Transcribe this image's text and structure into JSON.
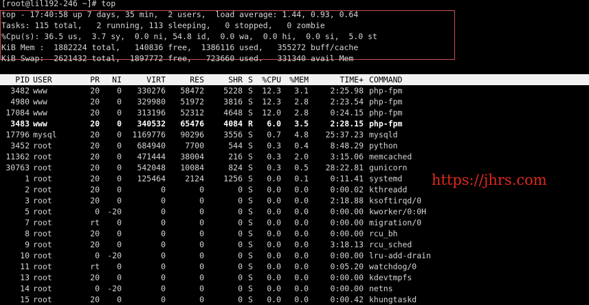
{
  "prompt_line": "[root@lil192-246 ~]# top",
  "summary": {
    "uptime": "top - 17:40:58 up 7 days, 35 min,  2 users,  load average: 1.44, 0.93, 0.64",
    "tasks": "Tasks: 115 total,   2 running, 113 sleeping,   0 stopped,   0 zombie",
    "cpu": "%Cpu(s): 36.5 us,  3.7 sy,  0.0 ni, 54.8 id,  0.0 wa,  0.0 hi,  0.0 si,  5.0 st",
    "mem": "KiB Mem :  1882224 total,   140836 free,  1386116 used,   355272 buff/cache",
    "swap": "KiB Swap:  2621432 total,  1897772 free,   723660 used.   331340 avail Mem"
  },
  "columns": [
    "PID",
    "USER",
    "PR",
    "NI",
    "VIRT",
    "RES",
    "SHR",
    "S",
    "%CPU",
    "%MEM",
    "TIME+",
    "COMMAND"
  ],
  "processes": [
    {
      "pid": "3482",
      "user": "www",
      "pr": "20",
      "ni": "0",
      "virt": "330276",
      "res": "58472",
      "shr": "5228",
      "s": "S",
      "cpu": "12.3",
      "mem": "3.1",
      "time": "2:25.98",
      "cmd": "php-fpm",
      "bold": false
    },
    {
      "pid": "4980",
      "user": "www",
      "pr": "20",
      "ni": "0",
      "virt": "329980",
      "res": "51972",
      "shr": "3816",
      "s": "S",
      "cpu": "12.3",
      "mem": "2.8",
      "time": "2:23.54",
      "cmd": "php-fpm",
      "bold": false
    },
    {
      "pid": "17084",
      "user": "www",
      "pr": "20",
      "ni": "0",
      "virt": "313196",
      "res": "52312",
      "shr": "4648",
      "s": "S",
      "cpu": "12.0",
      "mem": "2.8",
      "time": "0:24.15",
      "cmd": "php-fpm",
      "bold": false
    },
    {
      "pid": "3483",
      "user": "www",
      "pr": "20",
      "ni": "0",
      "virt": "340532",
      "res": "65476",
      "shr": "4084",
      "s": "R",
      "cpu": "6.0",
      "mem": "3.5",
      "time": "2:28.15",
      "cmd": "php-fpm",
      "bold": true
    },
    {
      "pid": "17796",
      "user": "mysql",
      "pr": "20",
      "ni": "0",
      "virt": "1169776",
      "res": "90296",
      "shr": "3556",
      "s": "S",
      "cpu": "0.7",
      "mem": "4.8",
      "time": "25:37.23",
      "cmd": "mysqld",
      "bold": false
    },
    {
      "pid": "3452",
      "user": "root",
      "pr": "20",
      "ni": "0",
      "virt": "684940",
      "res": "7700",
      "shr": "544",
      "s": "S",
      "cpu": "0.3",
      "mem": "0.4",
      "time": "8:48.29",
      "cmd": "python",
      "bold": false
    },
    {
      "pid": "11362",
      "user": "root",
      "pr": "20",
      "ni": "0",
      "virt": "471444",
      "res": "38004",
      "shr": "216",
      "s": "S",
      "cpu": "0.3",
      "mem": "2.0",
      "time": "3:15.06",
      "cmd": "memcached",
      "bold": false
    },
    {
      "pid": "30763",
      "user": "root",
      "pr": "20",
      "ni": "0",
      "virt": "542048",
      "res": "10084",
      "shr": "824",
      "s": "S",
      "cpu": "0.3",
      "mem": "0.5",
      "time": "28:22.81",
      "cmd": "gunicorn",
      "bold": false
    },
    {
      "pid": "1",
      "user": "root",
      "pr": "20",
      "ni": "0",
      "virt": "125464",
      "res": "2124",
      "shr": "1256",
      "s": "S",
      "cpu": "0.0",
      "mem": "0.1",
      "time": "0:11.41",
      "cmd": "systemd",
      "bold": false
    },
    {
      "pid": "2",
      "user": "root",
      "pr": "20",
      "ni": "0",
      "virt": "0",
      "res": "0",
      "shr": "0",
      "s": "S",
      "cpu": "0.0",
      "mem": "0.0",
      "time": "0:00.02",
      "cmd": "kthreadd",
      "bold": false
    },
    {
      "pid": "3",
      "user": "root",
      "pr": "20",
      "ni": "0",
      "virt": "0",
      "res": "0",
      "shr": "0",
      "s": "S",
      "cpu": "0.0",
      "mem": "0.0",
      "time": "2:18.88",
      "cmd": "ksoftirqd/0",
      "bold": false
    },
    {
      "pid": "5",
      "user": "root",
      "pr": "0",
      "ni": "-20",
      "virt": "0",
      "res": "0",
      "shr": "0",
      "s": "S",
      "cpu": "0.0",
      "mem": "0.0",
      "time": "0:00.00",
      "cmd": "kworker/0:0H",
      "bold": false
    },
    {
      "pid": "7",
      "user": "root",
      "pr": "rt",
      "ni": "0",
      "virt": "0",
      "res": "0",
      "shr": "0",
      "s": "S",
      "cpu": "0.0",
      "mem": "0.0",
      "time": "0:00.00",
      "cmd": "migration/0",
      "bold": false
    },
    {
      "pid": "8",
      "user": "root",
      "pr": "20",
      "ni": "0",
      "virt": "0",
      "res": "0",
      "shr": "0",
      "s": "S",
      "cpu": "0.0",
      "mem": "0.0",
      "time": "0:00.00",
      "cmd": "rcu_bh",
      "bold": false
    },
    {
      "pid": "9",
      "user": "root",
      "pr": "20",
      "ni": "0",
      "virt": "0",
      "res": "0",
      "shr": "0",
      "s": "S",
      "cpu": "0.0",
      "mem": "0.0",
      "time": "3:18.13",
      "cmd": "rcu_sched",
      "bold": false
    },
    {
      "pid": "10",
      "user": "root",
      "pr": "0",
      "ni": "-20",
      "virt": "0",
      "res": "0",
      "shr": "0",
      "s": "S",
      "cpu": "0.0",
      "mem": "0.0",
      "time": "0:00.00",
      "cmd": "lru-add-drain",
      "bold": false
    },
    {
      "pid": "11",
      "user": "root",
      "pr": "rt",
      "ni": "0",
      "virt": "0",
      "res": "0",
      "shr": "0",
      "s": "S",
      "cpu": "0.0",
      "mem": "0.0",
      "time": "0:05.20",
      "cmd": "watchdog/0",
      "bold": false
    },
    {
      "pid": "13",
      "user": "root",
      "pr": "20",
      "ni": "0",
      "virt": "0",
      "res": "0",
      "shr": "0",
      "s": "S",
      "cpu": "0.0",
      "mem": "0.0",
      "time": "0:00.00",
      "cmd": "kdevtmpfs",
      "bold": false
    },
    {
      "pid": "14",
      "user": "root",
      "pr": "0",
      "ni": "-20",
      "virt": "0",
      "res": "0",
      "shr": "0",
      "s": "S",
      "cpu": "0.0",
      "mem": "0.0",
      "time": "0:00.00",
      "cmd": "netns",
      "bold": false
    },
    {
      "pid": "15",
      "user": "root",
      "pr": "20",
      "ni": "0",
      "virt": "0",
      "res": "0",
      "shr": "0",
      "s": "S",
      "cpu": "0.0",
      "mem": "0.0",
      "time": "0:00.42",
      "cmd": "khungtaskd",
      "bold": false
    }
  ],
  "watermark": "https://jhrs.com",
  "colors": {
    "background": "#000000",
    "text": "#d6d6d6",
    "header_bar": "#f2f2f2",
    "highlight_box": "#d0505a",
    "watermark": "#e0281e"
  }
}
